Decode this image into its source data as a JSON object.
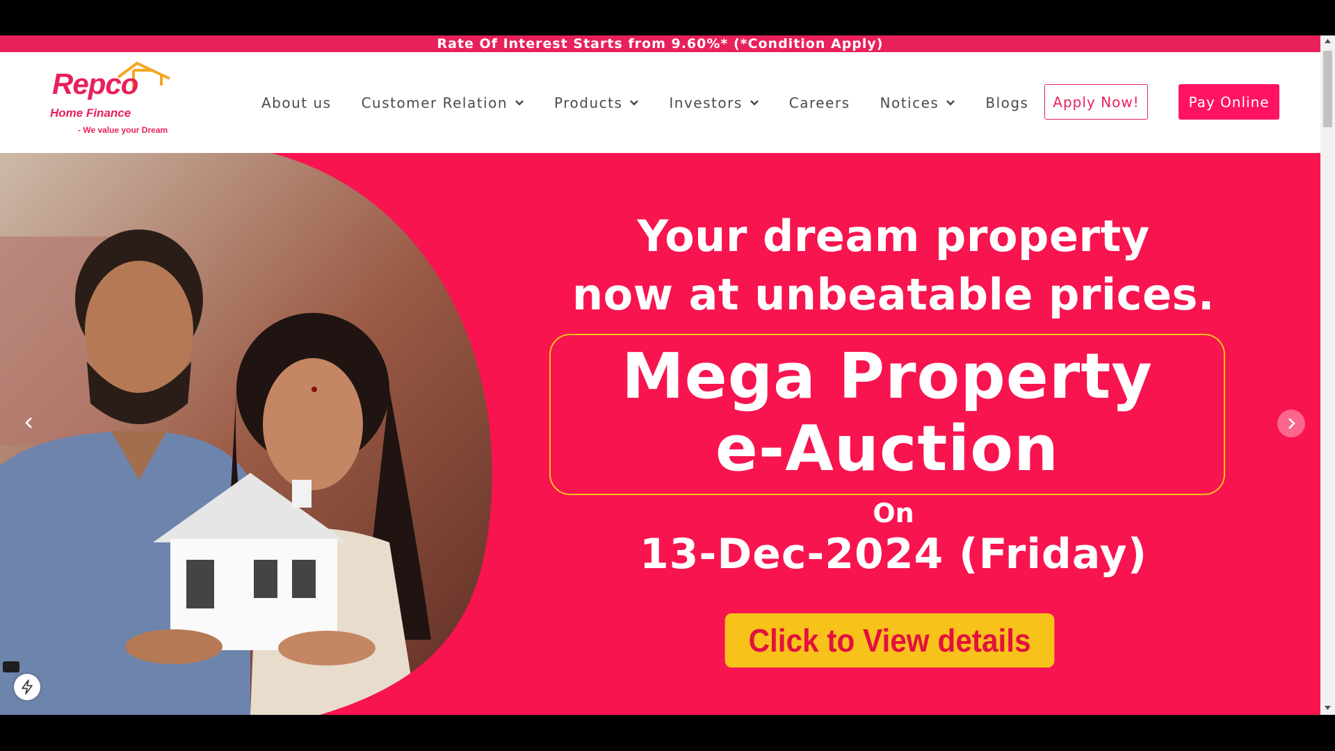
{
  "promo": {
    "text": "Rate Of Interest Starts from 9.60%* (*Condition Apply)"
  },
  "logo": {
    "brand": "Repco",
    "sub": "Home Finance",
    "tagline": "- We value your Dream"
  },
  "nav": {
    "items": [
      {
        "label": "About us",
        "dropdown": false
      },
      {
        "label": "Customer Relation",
        "dropdown": true
      },
      {
        "label": "Products",
        "dropdown": true
      },
      {
        "label": "Investors",
        "dropdown": true
      },
      {
        "label": "Careers",
        "dropdown": false
      },
      {
        "label": "Notices",
        "dropdown": true
      },
      {
        "label": "Blogs",
        "dropdown": false
      }
    ],
    "apply_label": "Apply Now!",
    "pay_label": "Pay Online"
  },
  "hero": {
    "headline_1": "Your dream property",
    "headline_2": "now at unbeatable prices.",
    "title_1": "Mega Property",
    "title_2": "e-Auction",
    "on": "On",
    "date": "13-Dec-2024 (Friday)",
    "cta": "Click to View details"
  },
  "colors": {
    "brand": "#ff1361",
    "promo": "#e8215a",
    "cta_bg": "#f7c21a",
    "cta_text": "#e2103f"
  },
  "icons": {
    "prev": "chevron-left-icon",
    "next": "chevron-right-icon",
    "bolt": "lightning-icon"
  }
}
